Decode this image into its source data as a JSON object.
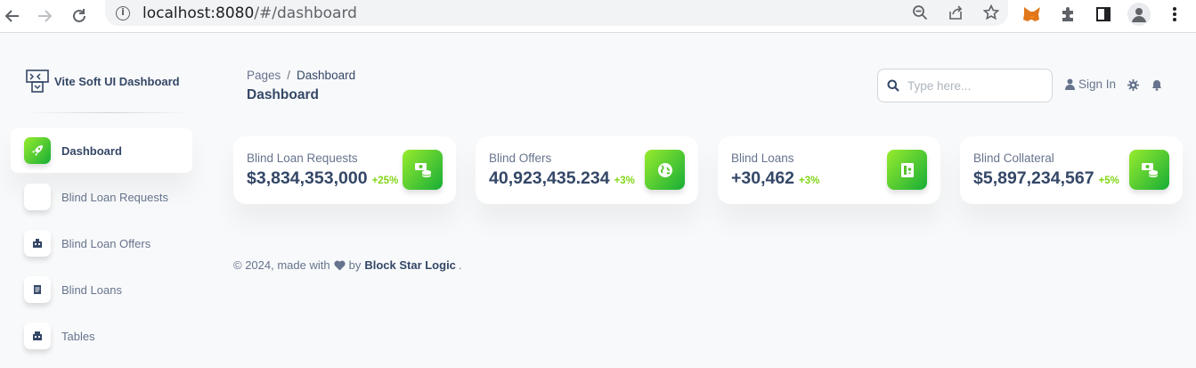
{
  "browser": {
    "url_host": "localhost:8080",
    "url_path": "/#/dashboard"
  },
  "brand": {
    "name": "Vite Soft UI Dashboard"
  },
  "sidebar": {
    "items": [
      {
        "label": "Dashboard",
        "active": true,
        "icon": "rocket-icon"
      },
      {
        "label": "Blind Loan Requests",
        "active": false,
        "icon": "blank-icon"
      },
      {
        "label": "Blind Loan Offers",
        "active": false,
        "icon": "building-icon"
      },
      {
        "label": "Blind Loans",
        "active": false,
        "icon": "document-icon"
      },
      {
        "label": "Tables",
        "active": false,
        "icon": "table-icon"
      }
    ]
  },
  "header": {
    "breadcrumb_root": "Pages",
    "breadcrumb_separator": "/",
    "breadcrumb_current": "Dashboard",
    "title": "Dashboard",
    "search_placeholder": "Type here...",
    "signin_label": "Sign In"
  },
  "cards": [
    {
      "title": "Blind Loan Requests",
      "value": "$3,834,353,000",
      "change": "+25%",
      "icon": "money-coins-icon"
    },
    {
      "title": "Blind Offers",
      "value": "40,923,435.234",
      "change": "+3%",
      "icon": "world-icon"
    },
    {
      "title": "Blind Loans",
      "value": "+30,462",
      "change": "+3%",
      "icon": "paper-diploma-icon"
    },
    {
      "title": "Blind Collateral",
      "value": "$5,897,234,567",
      "change": "+5%",
      "icon": "money-coins-icon"
    }
  ],
  "footer": {
    "prefix": "© 2024, made with",
    "by": "by",
    "company": "Block Star Logic",
    "suffix": "."
  },
  "colors": {
    "accent_gradient_start": "#17ad37",
    "accent_gradient_end": "#98ec2d",
    "positive_change": "#82d616",
    "text_dark": "#344767",
    "text_muted": "#67748e"
  }
}
